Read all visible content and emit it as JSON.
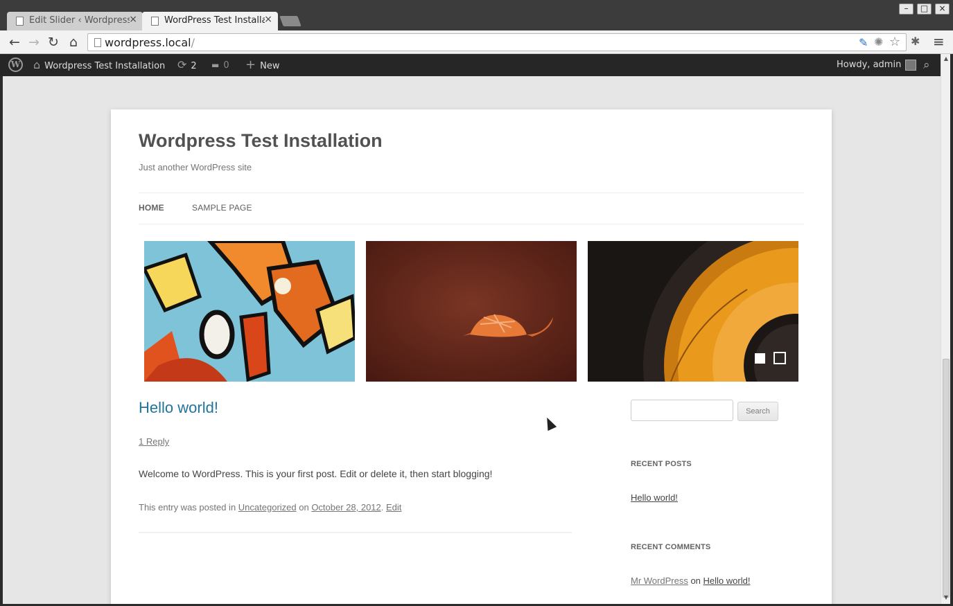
{
  "browser": {
    "tabs": [
      {
        "label": "Edit Slider ‹ Wordpress",
        "close": "×"
      },
      {
        "label": "WordPress Test Installa",
        "close": "×"
      }
    ],
    "window_buttons": {
      "minimize": "–",
      "maximize": "□",
      "close": "×"
    },
    "nav": {
      "back": "←",
      "forward": "→",
      "reload": "↻",
      "home": "⌂"
    },
    "url_main": "wordpress.local",
    "url_rest": "/",
    "icons": [
      "edit-extension-icon",
      "gear-extension-icon",
      "star-bookmark-icon",
      "tools-extension-icon",
      "menu-icon"
    ],
    "icon_glyphs": {
      "edit": "✎",
      "gear": "✺",
      "star": "☆",
      "tools": "✱",
      "menu": "≡"
    }
  },
  "adminbar": {
    "site_name": "Wordpress Test Installation",
    "updates_count": "2",
    "comments_count": "0",
    "new_label": "New",
    "howdy": "Howdy, admin",
    "glyphs": {
      "wp": "W",
      "home": "⌂",
      "updates": "⟳",
      "comments": "▬",
      "new": "+",
      "search": "⌕"
    }
  },
  "site": {
    "title": "Wordpress Test Installation",
    "description": "Just another WordPress site",
    "nav": [
      {
        "label": "HOME",
        "current": true
      },
      {
        "label": "SAMPLE PAGE",
        "current": false
      }
    ]
  },
  "slider": {
    "slides": [
      "graffiti",
      "armadillo",
      "speaker"
    ],
    "active_index": 0,
    "count": 2
  },
  "post": {
    "title": "Hello world!",
    "reply_link": "1 Reply",
    "body": "Welcome to WordPress. This is your first post. Edit or delete it, then start blogging!",
    "meta_prefix": "This entry was posted in ",
    "category": "Uncategorized",
    "meta_on": " on ",
    "date": "October 28, 2012",
    "meta_sep": ". ",
    "edit": "Edit"
  },
  "sidebar": {
    "search_button": "Search",
    "search_value": "",
    "recent_posts_title": "RECENT POSTS",
    "recent_posts": [
      "Hello world!"
    ],
    "recent_comments_title": "RECENT COMMENTS",
    "comment_author": "Mr WordPress",
    "comment_on": " on ",
    "comment_post": "Hello world!"
  },
  "colors": {
    "link": "#21759b",
    "adminbar": "#262626",
    "page_bg": "#e6e6e6"
  }
}
